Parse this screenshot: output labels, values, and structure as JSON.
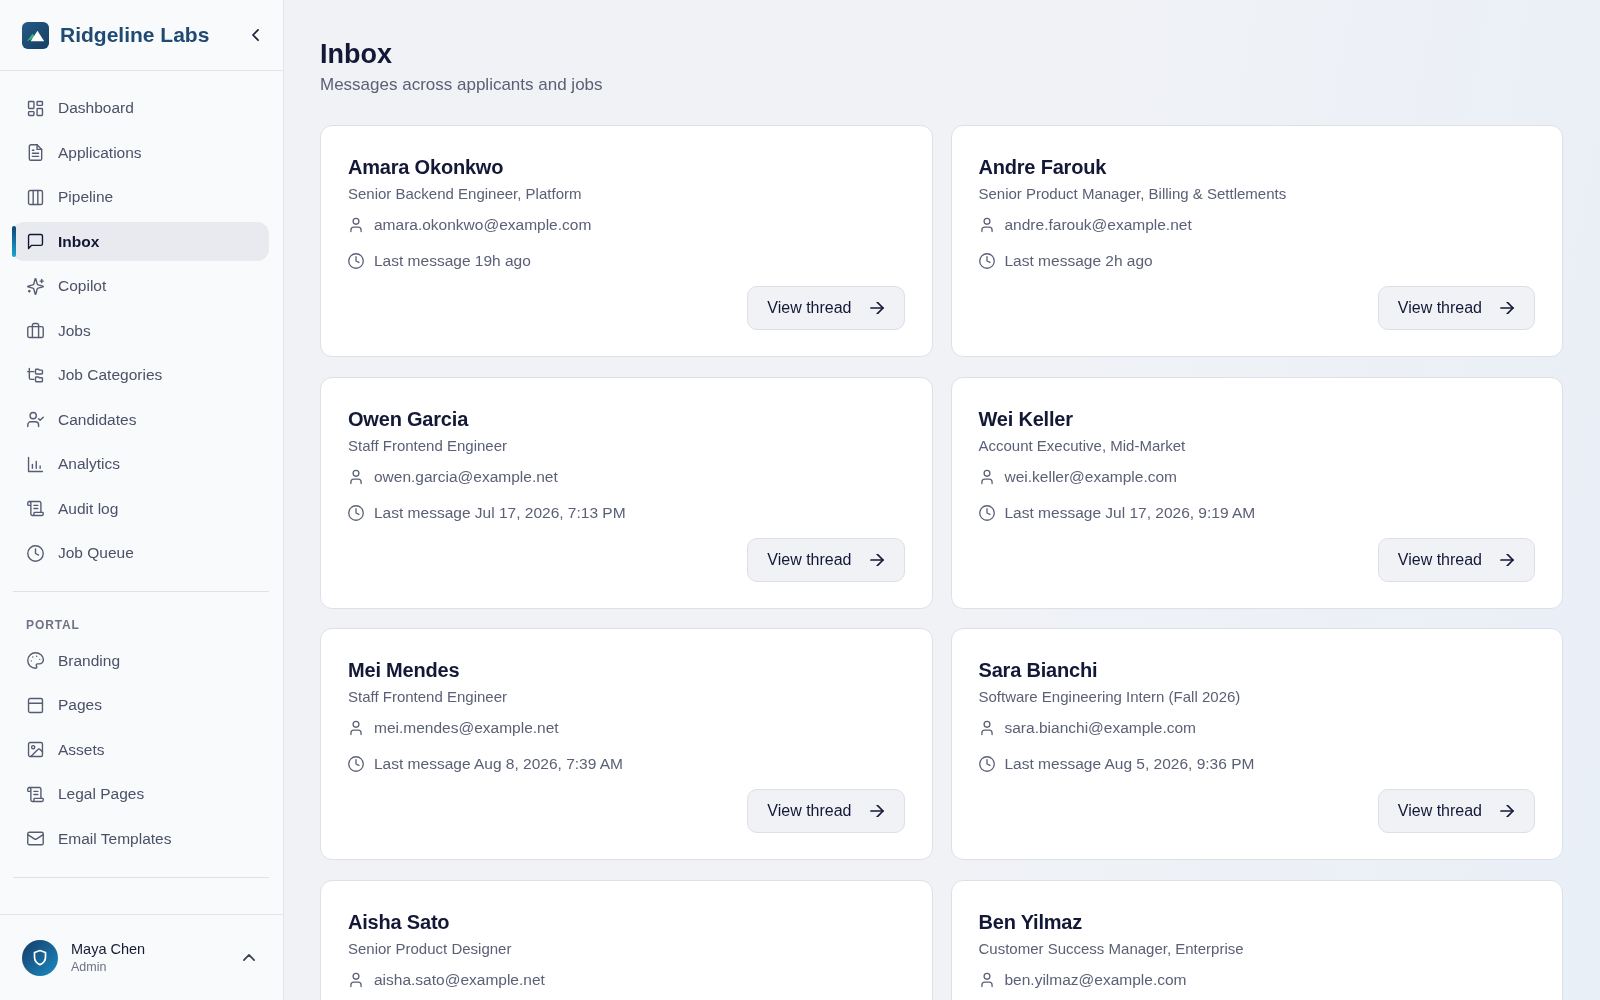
{
  "sidebar": {
    "brand": "Ridgeline Labs",
    "nav": [
      {
        "label": "Dashboard",
        "selected": false
      },
      {
        "label": "Applications",
        "selected": false
      },
      {
        "label": "Pipeline",
        "selected": false
      },
      {
        "label": "Inbox",
        "selected": true
      },
      {
        "label": "Copilot",
        "selected": false
      },
      {
        "label": "Jobs",
        "selected": false
      },
      {
        "label": "Job Categories",
        "selected": false
      },
      {
        "label": "Candidates",
        "selected": false
      },
      {
        "label": "Analytics",
        "selected": false
      },
      {
        "label": "Audit log",
        "selected": false
      },
      {
        "label": "Job Queue",
        "selected": false
      }
    ],
    "portal": {
      "heading": "PORTAL",
      "items": [
        {
          "label": "Branding",
          "selected": false
        },
        {
          "label": "Pages",
          "selected": false
        },
        {
          "label": "Assets",
          "selected": false
        },
        {
          "label": "Legal Pages",
          "selected": false
        },
        {
          "label": "Email Templates",
          "selected": false
        }
      ]
    },
    "user": {
      "name": "Maya Chen",
      "role": "Admin"
    }
  },
  "page": {
    "title": "Inbox",
    "subtitle": "Messages across applicants and jobs"
  },
  "threads": [
    {
      "name": "Amara Okonkwo",
      "job": "Senior Backend Engineer, Platform",
      "email": "amara.okonkwo@example.com",
      "last_message": "Last message 19h ago",
      "action": "View thread"
    },
    {
      "name": "Andre Farouk",
      "job": "Senior Product Manager, Billing & Settlements",
      "email": "andre.farouk@example.net",
      "last_message": "Last message 2h ago",
      "action": "View thread"
    },
    {
      "name": "Owen Garcia",
      "job": "Staff Frontend Engineer",
      "email": "owen.garcia@example.net",
      "last_message": "Last message Jul 17, 2026, 7:13 PM",
      "action": "View thread"
    },
    {
      "name": "Wei Keller",
      "job": "Account Executive, Mid-Market",
      "email": "wei.keller@example.com",
      "last_message": "Last message Jul 17, 2026, 9:19 AM",
      "action": "View thread"
    },
    {
      "name": "Mei Mendes",
      "job": "Staff Frontend Engineer",
      "email": "mei.mendes@example.net",
      "last_message": "Last message Aug 8, 2026, 7:39 AM",
      "action": "View thread"
    },
    {
      "name": "Sara Bianchi",
      "job": "Software Engineering Intern (Fall 2026)",
      "email": "sara.bianchi@example.com",
      "last_message": "Last message Aug 5, 2026, 9:36 PM",
      "action": "View thread"
    },
    {
      "name": "Aisha Sato",
      "job": "Senior Product Designer",
      "email": "aisha.sato@example.net"
    },
    {
      "name": "Ben Yilmaz",
      "job": "Customer Success Manager, Enterprise",
      "email": "ben.yilmaz@example.com"
    }
  ]
}
